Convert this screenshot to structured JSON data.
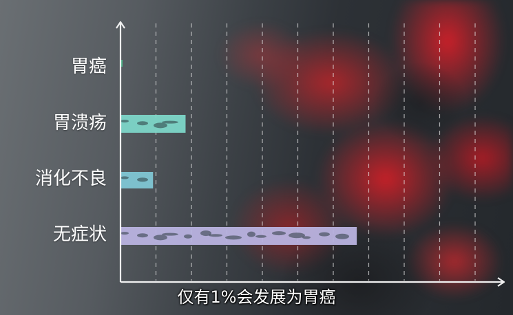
{
  "chart_data": {
    "type": "bar",
    "orientation": "horizontal",
    "categories": [
      "胃癌",
      "胃溃疡",
      "消化不良",
      "无症状"
    ],
    "values": [
      0.3,
      19,
      9.5,
      69
    ],
    "xlim": [
      0,
      110
    ],
    "grid": true,
    "colors": {
      "胃癌": "#4fb58a",
      "胃溃疡": "#7dd6c8",
      "消化不良": "#7fc6d4",
      "无症状": "#b9b3e0"
    },
    "axis_color": "#f2f2f2",
    "grid_color": "#e8e8e8"
  },
  "caption": "仅有1%会发展为胃癌"
}
